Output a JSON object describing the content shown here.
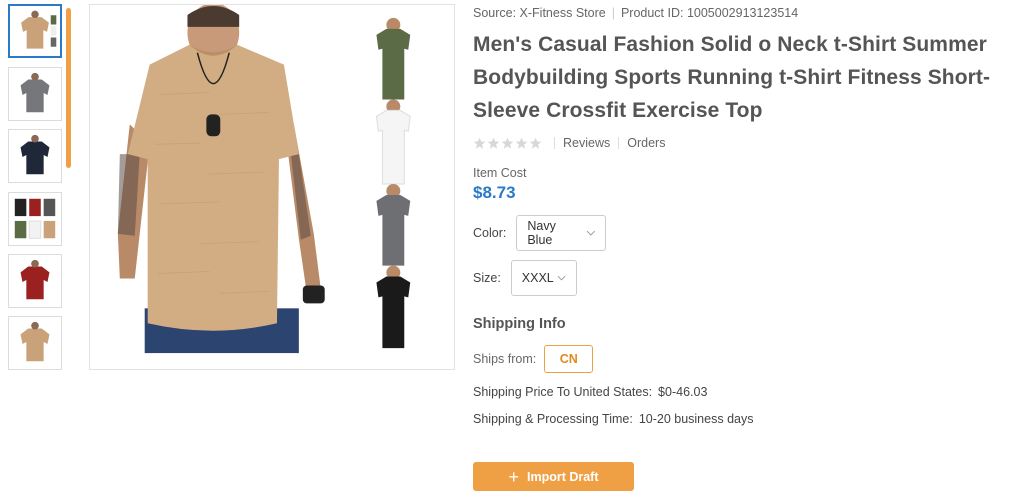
{
  "meta": {
    "source": "Source: X-Fitness Store",
    "product_id": "Product ID: 1005002913123514"
  },
  "product": {
    "title": "Men's Casual Fashion Solid o Neck t-Shirt Summer Bodybuilding Sports Running t-Shirt Fitness Short-Sleeve Crossfit Exercise Top",
    "rating_stars": 0,
    "reviews_label": "Reviews",
    "orders_label": "Orders",
    "cost_label": "Item Cost",
    "price": "$8.73"
  },
  "options": {
    "color_label": "Color:",
    "color_value": "Navy Blue",
    "size_label": "Size:",
    "size_value": "XXXL"
  },
  "shipping": {
    "title": "Shipping Info",
    "ships_from_label": "Ships from:",
    "ships_from_value": "CN",
    "price_label": "Shipping Price To United States:",
    "price_value": "$0-46.03",
    "time_label": "Shipping & Processing Time:",
    "time_value": "10-20 business days"
  },
  "actions": {
    "import_label": "Import Draft"
  },
  "thumbnails": [
    {
      "name": "thumb-khaki-shirt",
      "color": "#c9a27a",
      "selected": true
    },
    {
      "name": "thumb-grey-shirt",
      "color": "#76777a"
    },
    {
      "name": "thumb-navy-shirt",
      "color": "#1e2838"
    },
    {
      "name": "thumb-color-grid",
      "color": "#8a6d55"
    },
    {
      "name": "thumb-red-shirt",
      "color": "#9b2020"
    },
    {
      "name": "thumb-khaki-shirt-2",
      "color": "#c9a27a"
    }
  ],
  "colors": {
    "accent": "#f0a044",
    "price": "#2a7ac7",
    "shirt_main": "#d2ad83"
  }
}
